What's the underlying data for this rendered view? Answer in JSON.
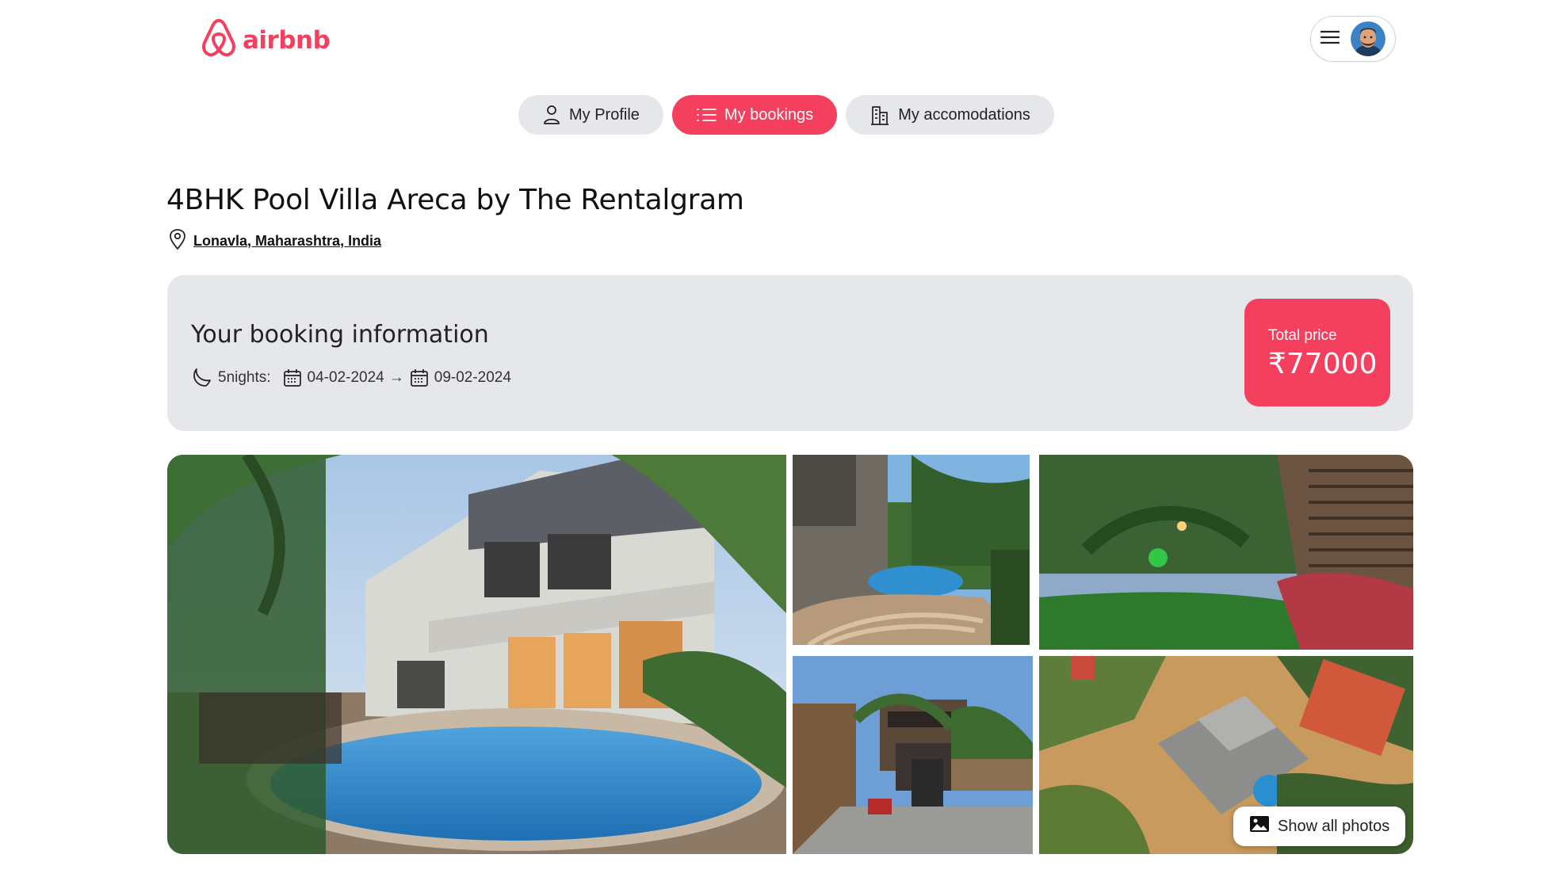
{
  "brand": {
    "name": "airbnb",
    "color": "#f43f5e"
  },
  "header": {
    "menu_icon": "hamburger-icon",
    "avatar": "user-avatar"
  },
  "tabs": [
    {
      "label": "My Profile",
      "icon": "user-icon",
      "active": false
    },
    {
      "label": "My bookings",
      "icon": "list-icon",
      "active": true
    },
    {
      "label": "My accomodations",
      "icon": "building-icon",
      "active": false
    }
  ],
  "place": {
    "title": "4BHK Pool Villa Areca by The Rentalgram",
    "address": "Lonavla, Maharashtra, India"
  },
  "booking": {
    "heading": "Your booking information",
    "nights": "5nights:",
    "check_in": "04-02-2024",
    "arrow": "→",
    "check_out": "09-02-2024",
    "price_label": "Total price",
    "price_value": "₹77000"
  },
  "gallery": {
    "show_all_label": "Show all photos",
    "photos": [
      "villa-pool-main",
      "garden-pool-steps",
      "garden-lawn-lights",
      "villa-gate-street",
      "aerial-roof-view"
    ]
  },
  "colors": {
    "accent": "#f43f5e",
    "panel": "#e5e7eb",
    "tab": "#e5e7eb"
  }
}
